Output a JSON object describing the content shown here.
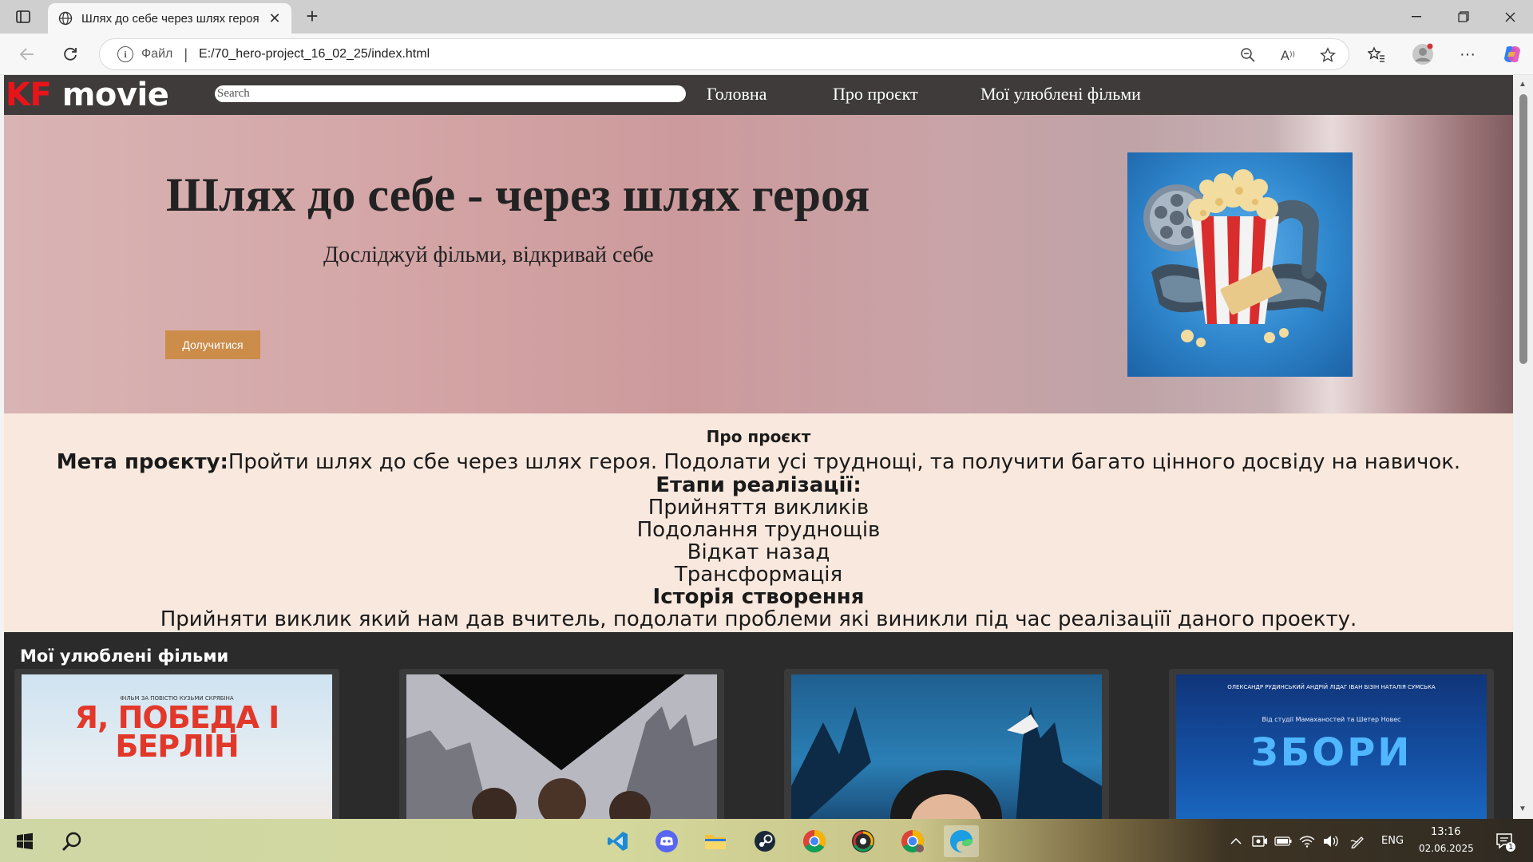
{
  "browser": {
    "tab_title": "Шлях до себе через шлях героя",
    "file_label": "Файл",
    "url": "E:/70_hero-project_16_02_25/index.html"
  },
  "site": {
    "logo_kf": "KF",
    "logo_movie": " movie",
    "search_placeholder": "Search",
    "nav": {
      "home": "Головна",
      "about": "Про проєкт",
      "favorites": "Мої улюблені фільми"
    },
    "hero": {
      "title": "Шлях до себе - через шлях героя",
      "subtitle": "Досліджуй фільми, відкривай себе",
      "button": "Долучитися"
    },
    "about": {
      "heading": "Про проєкт",
      "goal_label": "Мета проєкту:",
      "goal_text": "Пройти шлях до сбе через шлях героя. Подолати усі труднощі, та получити багато цінного досвіду на навичок.",
      "stages_heading": "Етапи реалізації:",
      "stages": [
        "Прийняття викликів",
        "Подолання труднощів",
        "Відкат назад",
        "Трансформація"
      ],
      "history_heading": "Історія створення",
      "history_text": "Прийняти виклик який нам дав вчитель, подолати проблеми які виникли під час реалізаціїї даного проекту."
    },
    "favorites": {
      "heading": "Мої улюблені фільми",
      "poster1": {
        "small_top": "ФІЛЬМ ЗА ПОВІСТЮ КУЗЬМИ СКРЯБІНА",
        "title": "Я, ПОБЕДА І БЕРЛІН"
      },
      "poster4": {
        "small_top": "ОЛЕКСАНДР РУДИНСЬКИЙ   АНДРІЙ ЛІДАГ   ІВАН БІЗІН   НАТАЛІЯ СУМСЬКА",
        "tagline": "Від студії Мамаханостей та Шетер Новес",
        "title": "ЗБОРИ"
      }
    }
  },
  "taskbar": {
    "lang": "ENG",
    "time": "13:16",
    "date": "02.06.2025",
    "notifications": "1"
  },
  "colors": {
    "site_header": "#3f3b3b",
    "logo_accent": "#e8141a",
    "hero_button": "#cc8c4a",
    "about_bg": "#f8e8dd",
    "favorites_bg": "#2b2b2b"
  }
}
